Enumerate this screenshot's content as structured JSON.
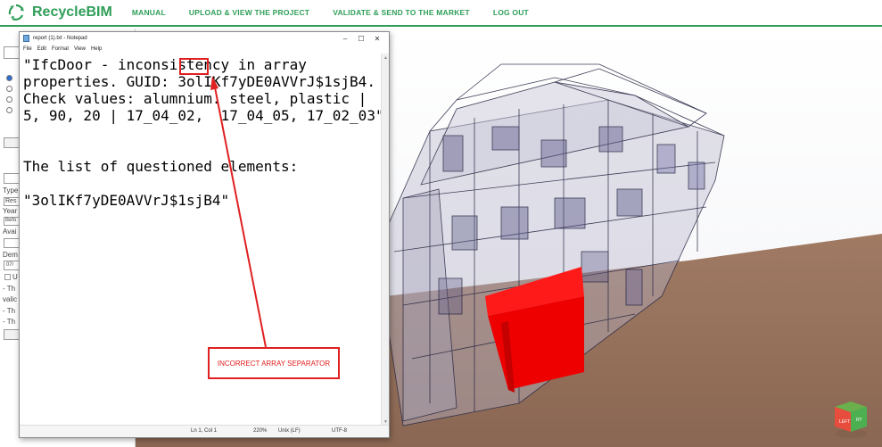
{
  "header": {
    "logo_text": "RecycleBIM",
    "nav": [
      "MANUAL",
      "UPLOAD & VIEW THE PROJECT",
      "VALIDATE & SEND TO THE MARKET",
      "LOG OUT"
    ],
    "accent": "#2f9e58"
  },
  "left_panel": {
    "labels": [
      "Type",
      "Res",
      "Year",
      "Befo",
      "Avai",
      "Dem",
      "07/",
      "U",
      "- Th",
      "valic",
      "- Th",
      "- Th"
    ]
  },
  "notepad": {
    "title": "report (1).txt - Notepad",
    "controls": [
      "–",
      "☐",
      "✕"
    ],
    "menu": [
      "File",
      "Edit",
      "Format",
      "View",
      "Help"
    ],
    "lines": [
      "\"IfcDoor - inconsistency in array",
      "properties. GUID: 3olIKf7yDE0AVVrJ$1sjB4.",
      "Check values: alumnium. steel, plastic |",
      "5, 90, 20 | 17_04_02,  17_04_05, 17_02_03\"",
      "",
      "",
      "The list of questioned elements:",
      "",
      "\"3olIKf7yDE0AVVrJ$1sjB4\""
    ],
    "status": {
      "position": "Ln 1, Col 1",
      "zoom": "220%",
      "line_ending": "Unix (LF)",
      "encoding": "UTF-8"
    }
  },
  "annotation": {
    "label": "INCORRECT ARRAY SEPARATOR",
    "color": "#e02020"
  },
  "viewcube": {
    "left": "LEFT",
    "right": "RT"
  }
}
